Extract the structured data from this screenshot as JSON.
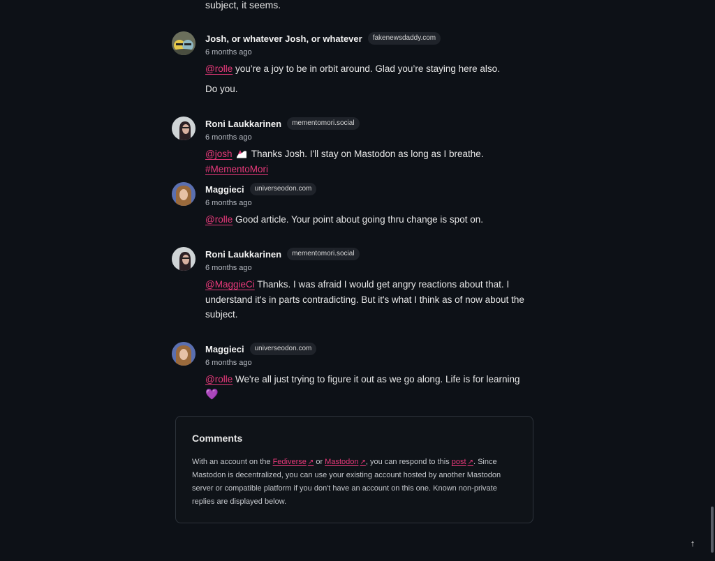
{
  "previous_tail": "subject, it seems.",
  "comments": [
    {
      "author": "Josh, or whatever Josh, or whatever",
      "instance": "fakenewsdaddy.com",
      "time": "6 months ago",
      "avatar_icon": "cartoon-avatar-icon",
      "paragraphs": [
        {
          "mention": "@rolle",
          "text": " you’re a joy to be in orbit around. Glad you’re staying here also."
        },
        {
          "mention": "",
          "text": "Do you."
        }
      ]
    },
    {
      "author": "Roni Laukkarinen",
      "instance": "mementomori.social",
      "time": "6 months ago",
      "avatar_icon": "person-avatar-icon",
      "mention": "@josh",
      "emoji_icon": "custom-emoji-icon",
      "text": " Thanks Josh. I'll stay on Mastodon as long as I breathe. ",
      "hashtag": "#MementoMori"
    },
    {
      "author": "Maggieci",
      "instance": "universeodon.com",
      "time": "6 months ago",
      "avatar_icon": "person-avatar-icon",
      "mention": "@rolle",
      "text": " Good article. Your point about going thru change is spot on."
    },
    {
      "author": "Roni Laukkarinen",
      "instance": "mementomori.social",
      "time": "6 months ago",
      "avatar_icon": "person-avatar-icon",
      "mention": "@MaggieCi",
      "text": " Thanks. I was afraid I would get angry reactions about that. I understand it's in parts contradicting. But it's what I think as of now about the subject."
    },
    {
      "author": "Maggieci",
      "instance": "universeodon.com",
      "time": "6 months ago",
      "avatar_icon": "person-avatar-icon",
      "mention": "@rolle",
      "text": " We're all just trying to figure it out as we go along. Life is for learning ",
      "emoji": "💜"
    }
  ],
  "comments_box": {
    "title": "Comments",
    "desc_1": "With an account on the ",
    "link_fediverse": "Fediverse",
    "desc_2": " or ",
    "link_mastodon": "Mastodon",
    "desc_3": ", you can respond to this ",
    "link_post": "post",
    "desc_4": ". Since Mastodon is decentralized, you can use your existing account hosted by another Mastodon server or compatible platform if you don't have an account on this one. Known non-private replies are displayed below.",
    "external_icon": "↗"
  },
  "back_to_top_icon": "↑",
  "colors": {
    "background": "#0d1117",
    "accent": "#e8397a"
  }
}
